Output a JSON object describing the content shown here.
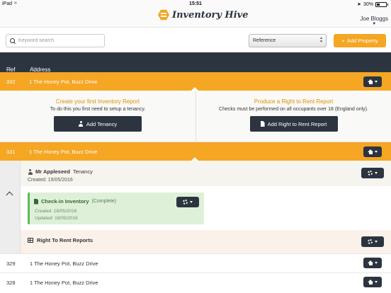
{
  "status_bar": {
    "device": "iPad",
    "time": "15:51",
    "battery": "30%"
  },
  "header": {
    "app_name": "Inventory Hive",
    "user_name": "Joe Bloggs"
  },
  "toolbar": {
    "search_placeholder": "Keyword search",
    "sort_select": "Reference",
    "add_property_label": "Add Property"
  },
  "table_header": {
    "ref": "Ref",
    "address": "Address"
  },
  "properties": [
    {
      "ref": "332",
      "address": "1 The Honey Pot, Buzz Drive",
      "inventory_title": "Create your first Inventory Report",
      "inventory_sub": "To do this you first need to setup a tenancy.",
      "add_tenancy_label": "Add Tenancy",
      "rtr_title": "Produce a Right to Rent Report",
      "rtr_sub": "Checks must be performed on all occupants over 18 (England only).",
      "add_rtr_label": "Add Right to Rent Report"
    },
    {
      "ref": "331",
      "address": "1 The Honey Pot, Buzz Drive",
      "tenant_name": "Mr Appleseed",
      "tenancy_word": "Tenancy",
      "created": "Created: 19/05/2016",
      "checkin_title": "Check-in Inventory",
      "checkin_status": "(Complete)",
      "checkin_created": "Created: 18/05/2016",
      "checkin_updated": "Updated: 18/05/2016",
      "rtr_section": "Right To Rent Reports"
    },
    {
      "ref": "329",
      "address": "1 The Honey Pot, Buzz Drive"
    },
    {
      "ref": "328",
      "address": "1 The Honey Pot, Buzz Drive"
    }
  ],
  "colors": {
    "accent": "#f5a623",
    "dark": "#2c3440",
    "success_bg": "#dff0d8"
  }
}
